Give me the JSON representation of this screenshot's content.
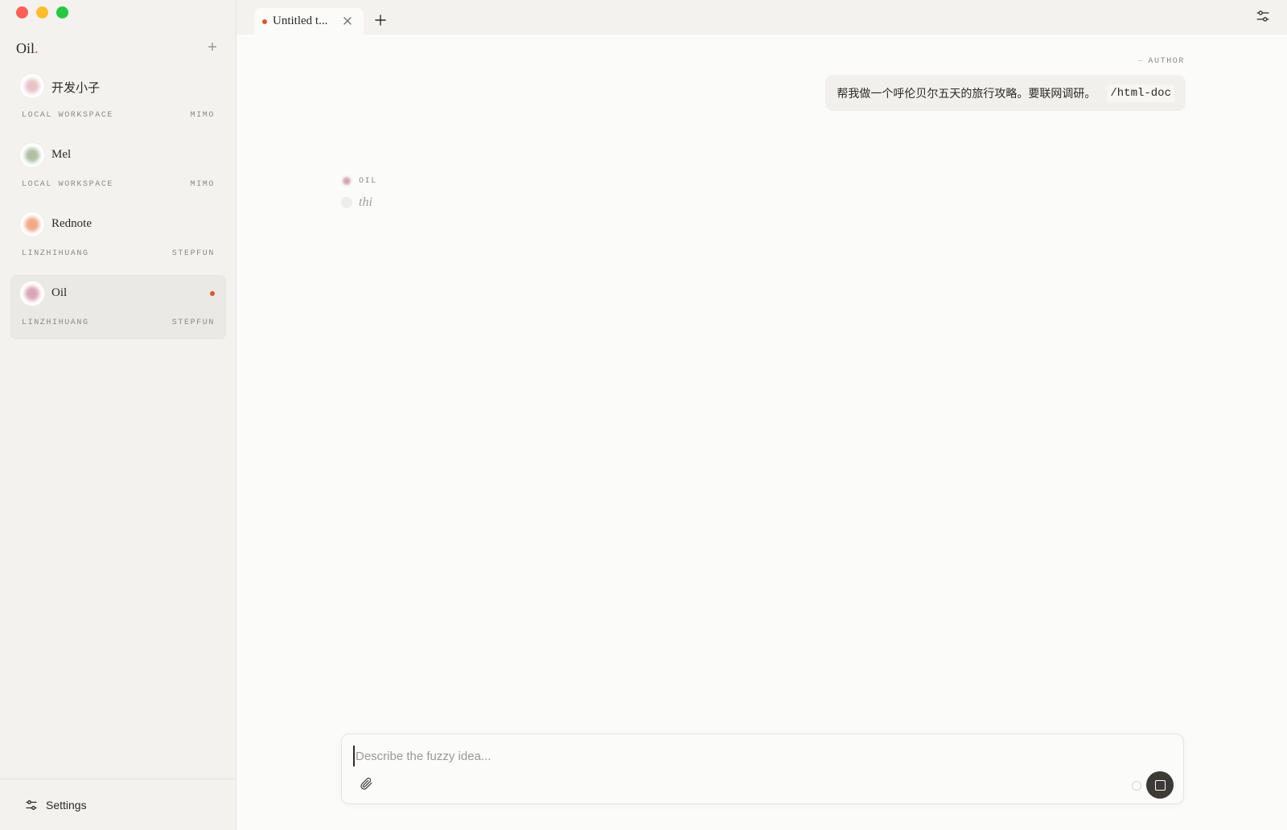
{
  "window": {
    "controls": [
      "close",
      "minimize",
      "zoom"
    ]
  },
  "sidebar": {
    "brand": "Oil",
    "brand_dot": ".",
    "add_label": "+",
    "projects": [
      {
        "name": "开发小子",
        "workspace": "LOCAL WORKSPACE",
        "model": "MIMO",
        "avatar_color": "#e8c3c8",
        "active": false,
        "unread": false
      },
      {
        "name": "Mel",
        "workspace": "LOCAL WORKSPACE",
        "model": "MIMO",
        "avatar_color": "#aebfa2",
        "active": false,
        "unread": false
      },
      {
        "name": "Rednote",
        "workspace": "LINZHIHUANG",
        "model": "STEPFUN",
        "avatar_color": "#f0a887",
        "active": false,
        "unread": false
      },
      {
        "name": "Oil",
        "workspace": "LINZHIHUANG",
        "model": "STEPFUN",
        "avatar_color": "#d9a6b8",
        "active": true,
        "unread": true
      }
    ],
    "settings_label": "Settings"
  },
  "tabs": {
    "items": [
      {
        "title": "Untitled t...",
        "modified": true
      }
    ],
    "new_tab_label": "+"
  },
  "conversation": {
    "author_label": "AUTHOR",
    "author_dash": "—",
    "user_message": "帮我做一个呼伦贝尔五天的旅行攻略。要联网调研。",
    "command_chip": "/html-doc",
    "assistant_name": "OIL",
    "assistant_text": "thi"
  },
  "composer": {
    "placeholder": "Describe the fuzzy idea...",
    "value": ""
  },
  "colors": {
    "accent": "#d9582f",
    "sidebar_bg": "#f3f2ef",
    "main_bg": "#fbfbfa",
    "stop_button": "#3d3934"
  },
  "icons": {
    "add": "plus-icon",
    "settings": "sliders-icon",
    "tab_close": "close-icon",
    "new_tab": "plus-icon",
    "panel_settings": "sliders-icon",
    "attach": "paperclip-icon",
    "stop": "stop-icon"
  }
}
